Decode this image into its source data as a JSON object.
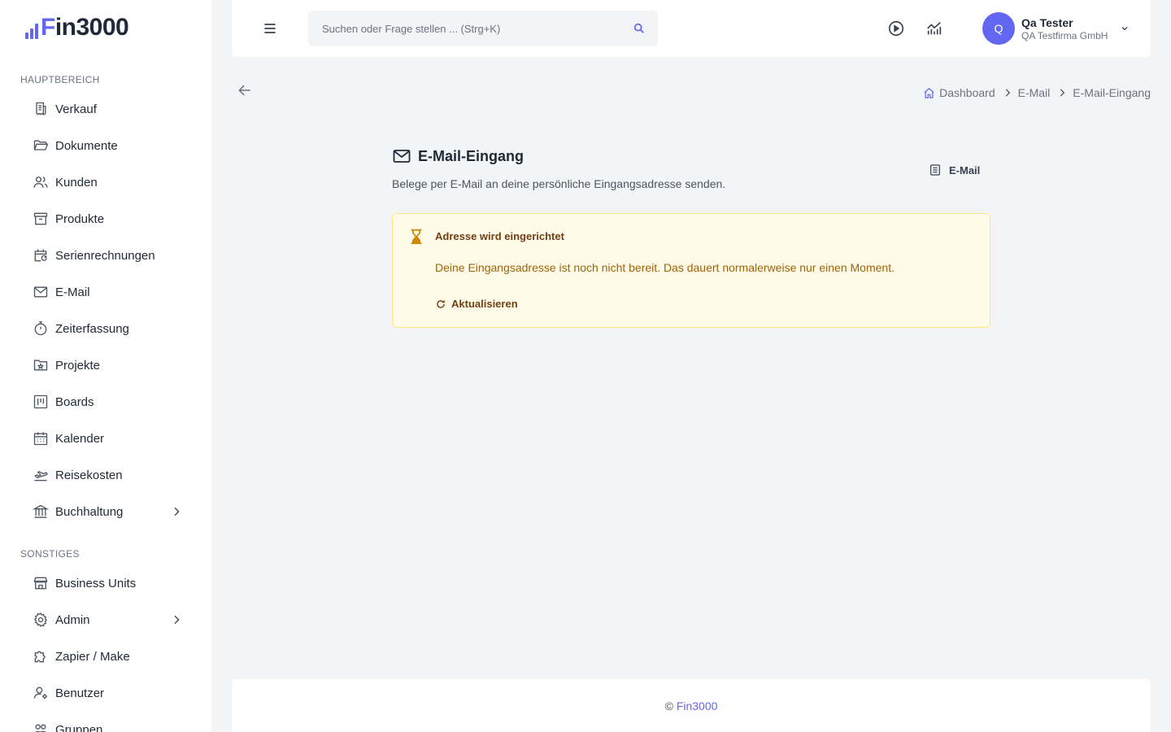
{
  "app": {
    "logo_text": "Fin3000",
    "brand_color": "#6366f1"
  },
  "sidebar": {
    "sections": [
      {
        "label": "HAUPTBEREICH"
      },
      {
        "label": "SONSTIGES"
      }
    ],
    "main_items": [
      {
        "label": "Verkauf",
        "icon": "receipt-icon"
      },
      {
        "label": "Dokumente",
        "icon": "folder-open-icon"
      },
      {
        "label": "Kunden",
        "icon": "users-icon"
      },
      {
        "label": "Produkte",
        "icon": "archive-box-icon"
      },
      {
        "label": "Serienrechnungen",
        "icon": "calendar-repeat-icon"
      },
      {
        "label": "E-Mail",
        "icon": "envelope-icon"
      },
      {
        "label": "Zeiterfassung",
        "icon": "stopwatch-icon"
      },
      {
        "label": "Projekte",
        "icon": "folder-star-icon"
      },
      {
        "label": "Boards",
        "icon": "kanban-icon"
      },
      {
        "label": "Kalender",
        "icon": "calendar-icon"
      },
      {
        "label": "Reisekosten",
        "icon": "plane-departure-icon"
      },
      {
        "label": "Buchhaltung",
        "icon": "bank-icon",
        "has_children": true
      }
    ],
    "other_items": [
      {
        "label": "Business Units",
        "icon": "storefront-icon"
      },
      {
        "label": "Admin",
        "icon": "gear-icon",
        "has_children": true
      },
      {
        "label": "Zapier / Make",
        "icon": "puzzle-icon"
      },
      {
        "label": "Benutzer",
        "icon": "user-cog-icon"
      },
      {
        "label": "Gruppen",
        "icon": "user-group-icon"
      }
    ]
  },
  "header": {
    "search_placeholder": "Suchen oder Frage stellen ... (Strg+K)",
    "user": {
      "initial": "Q",
      "name": "Qa Tester",
      "company": "QA Testfirma GmbH"
    }
  },
  "breadcrumb": {
    "items": [
      "Dashboard",
      "E-Mail",
      "E-Mail-Eingang"
    ]
  },
  "page": {
    "title": "E-Mail-Eingang",
    "subtitle": "Belege per E-Mail an deine persönliche Eingangsadresse senden.",
    "email_link": "E-Mail"
  },
  "alert": {
    "title": "Adresse wird eingerichtet",
    "text": "Deine Eingangsadresse ist noch nicht bereit. Das dauert normalerweise nur einen Moment.",
    "button": "Aktualisieren",
    "color": "#ca8a04"
  },
  "footer": {
    "copyright": "©",
    "brand": "Fin3000"
  }
}
